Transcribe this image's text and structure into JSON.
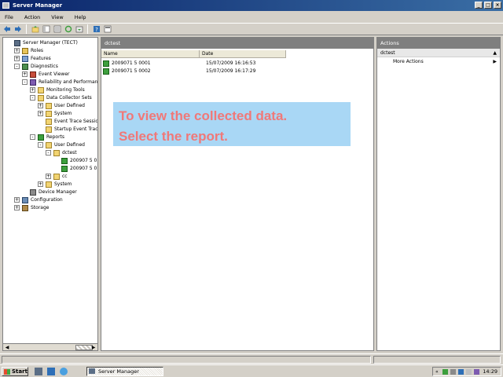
{
  "window": {
    "title": "Server Manager"
  },
  "menu": [
    "File",
    "Action",
    "View",
    "Help"
  ],
  "toolbar": {
    "icons": [
      "back-icon",
      "forward-icon",
      "up-folder-icon",
      "show-hide-tree-icon",
      "properties-icon",
      "refresh-icon",
      "export-icon",
      "help-icon",
      "console-icon"
    ]
  },
  "tree": [
    {
      "label": "Server Manager (TECT)",
      "icon": "server",
      "depth": 0,
      "exp": ""
    },
    {
      "label": "Roles",
      "icon": "roles",
      "depth": 1,
      "exp": "+"
    },
    {
      "label": "Features",
      "icon": "features",
      "depth": 1,
      "exp": "+"
    },
    {
      "label": "Diagnostics",
      "icon": "diag",
      "depth": 1,
      "exp": "-"
    },
    {
      "label": "Event Viewer",
      "icon": "event",
      "depth": 2,
      "exp": "+"
    },
    {
      "label": "Reliability and Performance",
      "icon": "perf",
      "depth": 2,
      "exp": "-"
    },
    {
      "label": "Monitoring Tools",
      "icon": "folder",
      "depth": 3,
      "exp": "+"
    },
    {
      "label": "Data Collector Sets",
      "icon": "folder",
      "depth": 3,
      "exp": "-"
    },
    {
      "label": "User Defined",
      "icon": "folder",
      "depth": 4,
      "exp": "+"
    },
    {
      "label": "System",
      "icon": "folder",
      "depth": 4,
      "exp": "+"
    },
    {
      "label": "Event Trace Sessio",
      "icon": "folder",
      "depth": 4,
      "exp": ""
    },
    {
      "label": "Startup Event Trac",
      "icon": "folder",
      "depth": 4,
      "exp": ""
    },
    {
      "label": "Reports",
      "icon": "report",
      "depth": 3,
      "exp": "-"
    },
    {
      "label": "User Defined",
      "icon": "folder",
      "depth": 4,
      "exp": "-"
    },
    {
      "label": "dctest",
      "icon": "folder",
      "depth": 5,
      "exp": "-"
    },
    {
      "label": "200907 5 0",
      "icon": "report",
      "depth": 6,
      "exp": ""
    },
    {
      "label": "200907 5 0",
      "icon": "report",
      "depth": 6,
      "exp": ""
    },
    {
      "label": "cc",
      "icon": "folder",
      "depth": 5,
      "exp": "+"
    },
    {
      "label": "System",
      "icon": "folder",
      "depth": 4,
      "exp": "+"
    },
    {
      "label": "Device Manager",
      "icon": "device",
      "depth": 2,
      "exp": ""
    },
    {
      "label": "Configuration",
      "icon": "config",
      "depth": 1,
      "exp": "+"
    },
    {
      "label": "Storage",
      "icon": "storage",
      "depth": 1,
      "exp": "+"
    }
  ],
  "center": {
    "header": "dctest",
    "columns": [
      "Name",
      "Date"
    ],
    "rows": [
      {
        "name": "2009071 5 0001",
        "date": "15/07/2009 16:16:53"
      },
      {
        "name": "2009071 5 0002",
        "date": "15/07/2009 16:17:29"
      }
    ]
  },
  "callout": {
    "line1": "To view the collected data.",
    "line2": "Select the report.",
    "bg": "#a9d7f5",
    "text_color": "#f07878"
  },
  "actions": {
    "title": "Actions",
    "section": "dctest",
    "item": "More Actions"
  },
  "taskbar": {
    "start": "Start",
    "task": "Server Manager",
    "clock": "14:29"
  }
}
